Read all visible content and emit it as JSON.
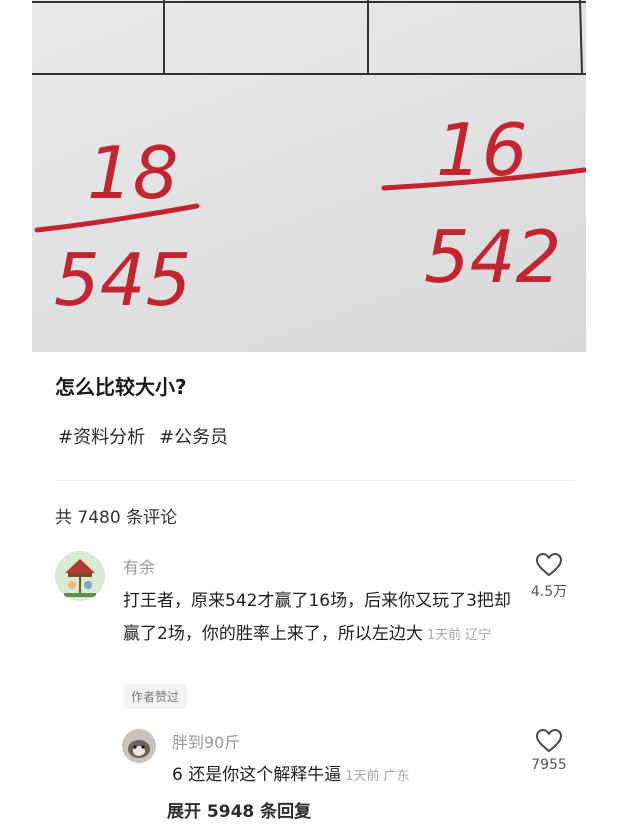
{
  "photo": {
    "left_fraction": {
      "numerator": "18",
      "denominator": "545"
    },
    "right_fraction": {
      "numerator": "16",
      "denominator": "542"
    },
    "ink_color": "#c2252f"
  },
  "post": {
    "title": "怎么比较大小?",
    "tags": [
      "#资料分析",
      "#公务员"
    ]
  },
  "comments_header": {
    "count_text": "共 7480 条评论"
  },
  "comments": [
    {
      "username": "有余",
      "text": "打王者，原来542才赢了16场，后来你又玩了3把却赢了2场，你的胜率上来了，所以左边大",
      "time": "1天前",
      "location": "辽宁",
      "badge": "作者赞过",
      "likes": "4.5万",
      "replies": [
        {
          "username": "胖到90斤",
          "text": "6 还是你这个解释牛逼",
          "time": "1天前",
          "location": "广东",
          "likes": "7955"
        }
      ],
      "expand_label": "展开 5948 条回复"
    }
  ],
  "icons": {
    "like": "heart-outline-icon",
    "avatar1": "carousel-avatar-icon",
    "avatar2": "cat-avatar-icon"
  }
}
